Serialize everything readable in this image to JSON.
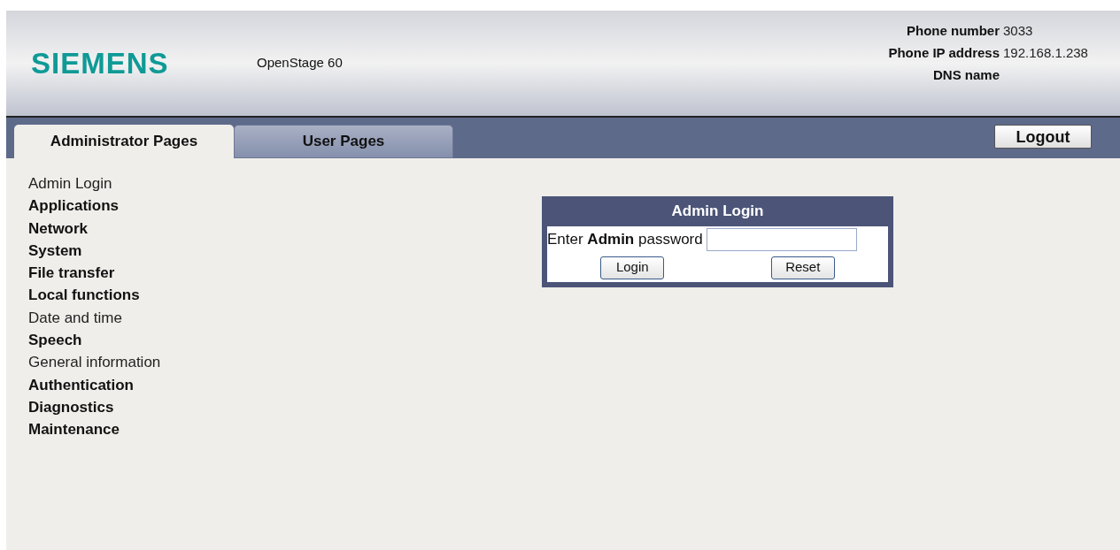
{
  "header": {
    "logo": "SIEMENS",
    "model": "OpenStage 60",
    "info": [
      {
        "label": "Phone number",
        "value": "3033"
      },
      {
        "label": "Phone IP address",
        "value": "192.168.1.238"
      },
      {
        "label": "DNS name"
      }
    ]
  },
  "tabs": [
    {
      "label": "Administrator Pages",
      "selected": true
    },
    {
      "label": "User Pages",
      "selected": false
    }
  ],
  "logout": "Logout",
  "sidebar": {
    "items": [
      {
        "label": "Admin Login",
        "kind": "page"
      },
      {
        "label": "Applications",
        "kind": "group"
      },
      {
        "label": "Network",
        "kind": "group"
      },
      {
        "label": "System",
        "kind": "group"
      },
      {
        "label": "File transfer",
        "kind": "group"
      },
      {
        "label": "Local functions",
        "kind": "group"
      },
      {
        "label": "Date and time",
        "kind": "page"
      },
      {
        "label": "Speech",
        "kind": "group"
      },
      {
        "label": "General information",
        "kind": "page"
      },
      {
        "label": "Authentication",
        "kind": "group"
      },
      {
        "label": "Diagnostics",
        "kind": "group"
      },
      {
        "label": "Maintenance",
        "kind": "group"
      }
    ]
  },
  "login": {
    "title": "Admin Login",
    "prompt": "Enter **Admin** password",
    "buttons": [
      "Login",
      "Reset"
    ]
  }
}
